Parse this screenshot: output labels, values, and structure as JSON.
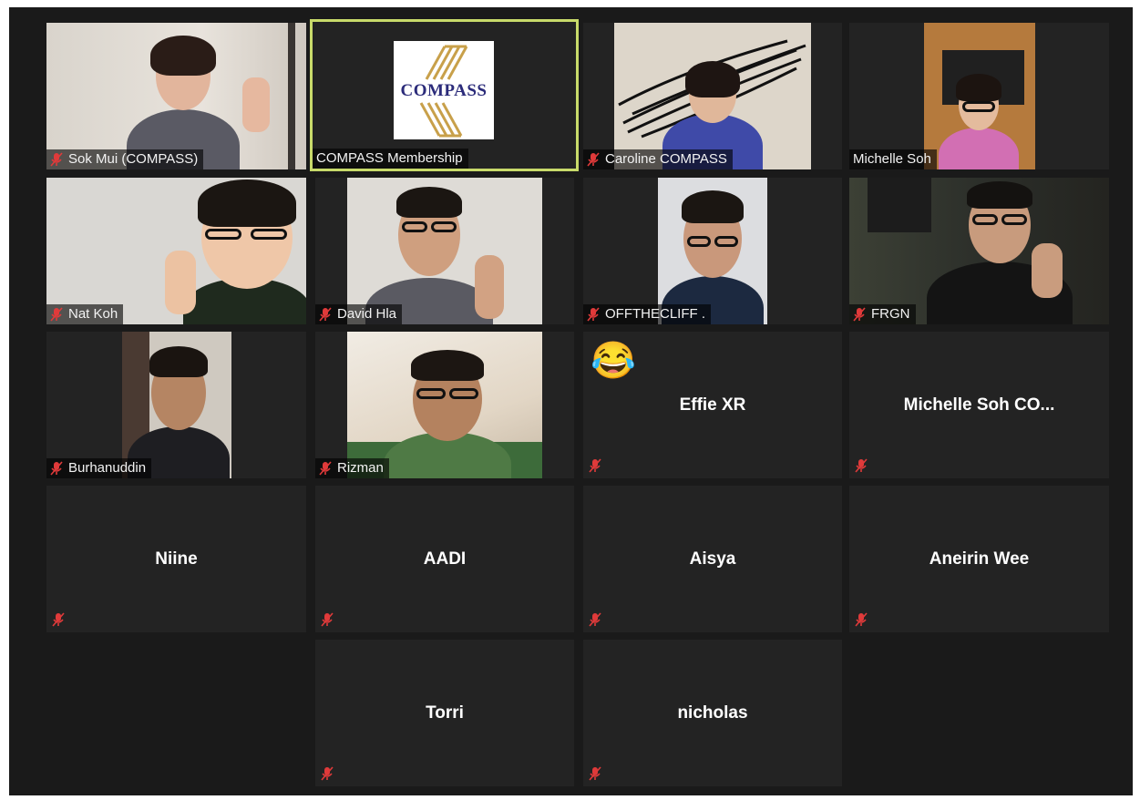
{
  "participants": [
    {
      "name": "Sok Mui (COMPASS)",
      "video": true
    },
    {
      "name": "COMPASS Membership",
      "video": true,
      "active_speaker": true,
      "logo_text": "COMPASS"
    },
    {
      "name": "Caroline COMPASS",
      "video": true
    },
    {
      "name": "Michelle Soh",
      "video": true
    },
    {
      "name": "Nat Koh",
      "video": true
    },
    {
      "name": "David Hla",
      "video": true
    },
    {
      "name": "OFFTHECLIFF .",
      "video": true
    },
    {
      "name": "FRGN",
      "video": true
    },
    {
      "name": "Burhanuddin",
      "video": true
    },
    {
      "name": "Rizman",
      "video": true
    },
    {
      "name": "Effie XR",
      "video": false,
      "reaction": "😂"
    },
    {
      "name": "Michelle  Soh  CO...",
      "video": false
    },
    {
      "name": "Niine",
      "video": false
    },
    {
      "name": "AADI",
      "video": false
    },
    {
      "name": "Aisya",
      "video": false
    },
    {
      "name": "Aneirin Wee",
      "video": false
    },
    {
      "name": "Torri",
      "video": false
    },
    {
      "name": "nicholas",
      "video": false
    }
  ],
  "colors": {
    "background": "#1a1a1a",
    "tile": "#232323",
    "active_border": "#c8da6a",
    "mute_icon": "#e03a3a",
    "logo_gold": "#c8a04a",
    "logo_navy": "#2b2b7a"
  },
  "icons": {
    "mute": "microphone-muted-icon"
  }
}
